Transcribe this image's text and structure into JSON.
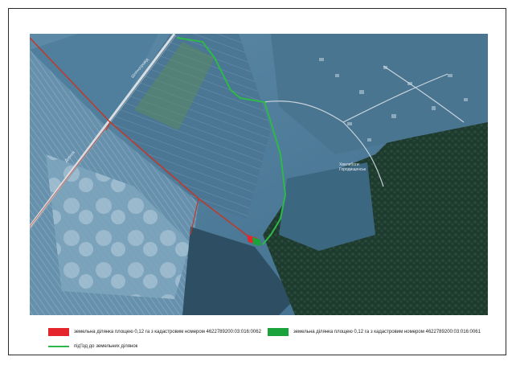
{
  "legend": {
    "red_parcel": "земельна ділянка площею 0,12 га з кадастровим номером 4622789200:03:016:0062",
    "green_parcel": "земельна ділянка площею 0,12 га з кадастровим номером 4622789200:03:016:0061",
    "access_road": "під'їзд до земельних ділянок"
  },
  "colors": {
    "red": "#e4252b",
    "green": "#1aa33a",
    "road_line": "#2fb84a",
    "boundary": "#c0392b"
  },
  "map_labels": {
    "road_label_top": "Шляхопровід",
    "road_label_left": "Дорога",
    "village_label": "Хвалибоги\nГородищенськ"
  }
}
